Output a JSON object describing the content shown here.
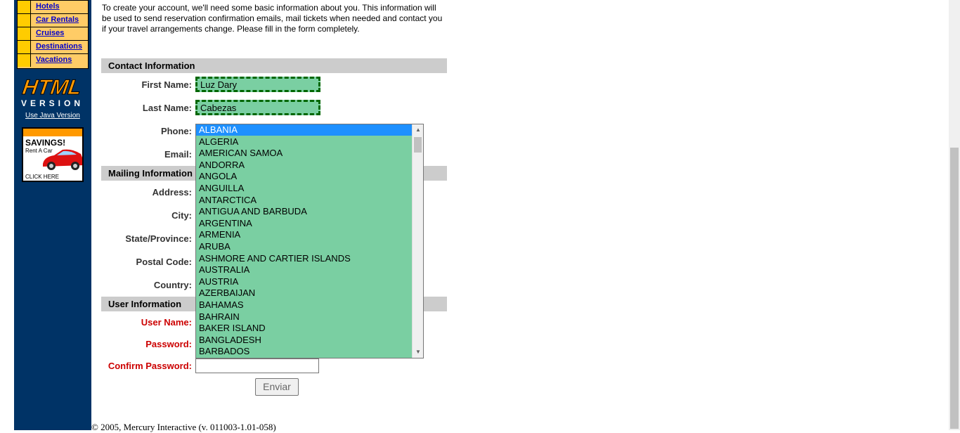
{
  "nav": {
    "items": [
      {
        "label": "Hotels"
      },
      {
        "label": "Car Rentals"
      },
      {
        "label": "Cruises"
      },
      {
        "label": "Destinations"
      },
      {
        "label": "Vacations"
      }
    ]
  },
  "logo": {
    "big": "HTML",
    "sub": "VERSION"
  },
  "java_link": "Use Java Version",
  "ad": {
    "headline": "SAVINGS!",
    "sub": "Rent A Car",
    "cta": "CLICK HERE"
  },
  "intro": "To create your account, we'll need some basic information about you. This information will be used to send reservation confirmation emails, mail tickets when needed and contact you if your travel arrangements change. Please fill in the form completely.",
  "sections": {
    "contact": "Contact Information",
    "mailing": "Mailing Information",
    "user": "User Information"
  },
  "labels": {
    "first_name": "First Name:",
    "last_name": "Last Name:",
    "phone": "Phone:",
    "email": "Email:",
    "address": "Address:",
    "city": "City:",
    "state": "State/Province:",
    "postal": "Postal Code:",
    "country": "Country:",
    "user_name": "User Name:",
    "password": "Password:",
    "confirm_password": "Confirm Password:"
  },
  "values": {
    "first_name": "Luz Dary",
    "last_name": "Cabezas",
    "confirm_password": ""
  },
  "country_options": [
    "ALBANIA",
    "ALGERIA",
    "AMERICAN SAMOA",
    "ANDORRA",
    "ANGOLA",
    "ANGUILLA",
    "ANTARCTICA",
    "ANTIGUA AND BARBUDA",
    "ARGENTINA",
    "ARMENIA",
    "ARUBA",
    "ASHMORE AND CARTIER ISLANDS",
    "AUSTRALIA",
    "AUSTRIA",
    "AZERBAIJAN",
    "BAHAMAS",
    "BAHRAIN",
    "BAKER ISLAND",
    "BANGLADESH",
    "BARBADOS"
  ],
  "selected_country": "ALBANIA",
  "submit_label": "Enviar",
  "copyright": "© 2005, Mercury Interactive (v. 011003-1.01-058)",
  "colors": {
    "filled_field": "#7acfa2",
    "sidebar": "#003366",
    "nav_bg": "#ffcc66",
    "required_label": "#cc0000"
  }
}
